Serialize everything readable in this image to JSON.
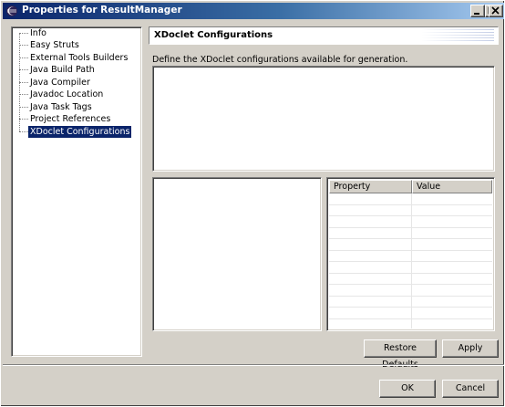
{
  "window": {
    "title": "Properties for ResultManager"
  },
  "tree": {
    "items": [
      {
        "label": "Info",
        "selected": false
      },
      {
        "label": "Easy Struts",
        "selected": false
      },
      {
        "label": "External Tools Builders",
        "selected": false
      },
      {
        "label": "Java Build Path",
        "selected": false
      },
      {
        "label": "Java Compiler",
        "selected": false
      },
      {
        "label": "Javadoc Location",
        "selected": false
      },
      {
        "label": "Java Task Tags",
        "selected": false
      },
      {
        "label": "Project References",
        "selected": false
      },
      {
        "label": "XDoclet Configurations",
        "selected": true
      }
    ]
  },
  "page": {
    "title": "XDoclet Configurations",
    "description": "Define the XDoclet configurations available for generation."
  },
  "table": {
    "columns": [
      "Property",
      "Value"
    ]
  },
  "buttons": {
    "restore_defaults": "Restore Defaults",
    "apply": "Apply",
    "ok": "OK",
    "cancel": "Cancel"
  },
  "colors": {
    "titlebar_start": "#0a246a",
    "titlebar_end": "#a6caf0",
    "selection": "#0a246a",
    "dialog_bg": "#d4d0c8"
  }
}
